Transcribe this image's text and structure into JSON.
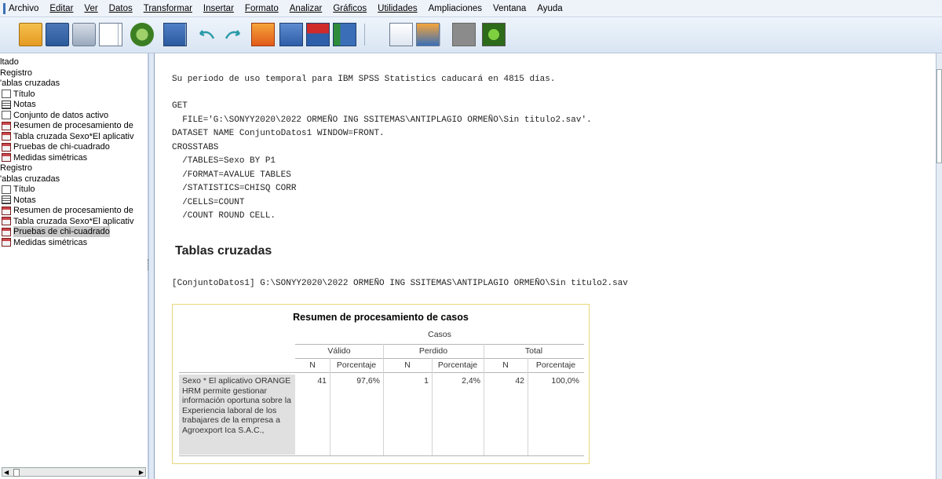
{
  "menu": [
    "Archivo",
    "Editar",
    "Ver",
    "Datos",
    "Transformar",
    "Insertar",
    "Formato",
    "Analizar",
    "Gráficos",
    "Utilidades",
    "Ampliaciones",
    "Ventana",
    "Ayuda"
  ],
  "toolbar_icons": [
    "open-icon",
    "save-icon",
    "print-icon",
    "print-preview-icon",
    "export-icon",
    "goto-data-icon",
    "undo-icon",
    "redo-icon",
    "goto-case-icon",
    "goto-variable-icon",
    "insert-case-icon",
    "insert-variable-icon",
    "edit-icon",
    "script-icon",
    "disabled-icon",
    "add-output-icon"
  ],
  "outline": [
    {
      "label": "ltado",
      "indent": 0,
      "icon": "none"
    },
    {
      "label": "Registro",
      "indent": 0,
      "icon": "none"
    },
    {
      "label": "'ablas cruzadas",
      "indent": 0,
      "icon": "none"
    },
    {
      "label": "Título",
      "indent": 1,
      "icon": "doc"
    },
    {
      "label": "Notas",
      "indent": 1,
      "icon": "note"
    },
    {
      "label": "Conjunto de datos activo",
      "indent": 1,
      "icon": "doc"
    },
    {
      "label": "Resumen de procesamiento de",
      "indent": 1,
      "icon": "tbl"
    },
    {
      "label": "Tabla cruzada Sexo*El aplicativ",
      "indent": 1,
      "icon": "tbl"
    },
    {
      "label": "Pruebas de chi-cuadrado",
      "indent": 1,
      "icon": "tbl"
    },
    {
      "label": "Medidas simétricas",
      "indent": 1,
      "icon": "tbl"
    },
    {
      "label": "Registro",
      "indent": 0,
      "icon": "none"
    },
    {
      "label": "'ablas cruzadas",
      "indent": 0,
      "icon": "none"
    },
    {
      "label": "Título",
      "indent": 1,
      "icon": "doc"
    },
    {
      "label": "Notas",
      "indent": 1,
      "icon": "note"
    },
    {
      "label": "Resumen de procesamiento de",
      "indent": 1,
      "icon": "tbl"
    },
    {
      "label": "Tabla cruzada Sexo*El aplicativ",
      "indent": 1,
      "icon": "tbl"
    },
    {
      "label": "Pruebas de chi-cuadrado",
      "indent": 1,
      "icon": "tbl",
      "selected": true
    },
    {
      "label": "Medidas simétricas",
      "indent": 1,
      "icon": "tbl"
    }
  ],
  "content": {
    "license_msg": "Su periodo de uso temporal para IBM SPSS Statistics caducará en 4815 días.",
    "syntax": [
      "GET",
      "  FILE='G:\\SONYY2020\\2022 ORMEÑO ING SSITEMAS\\ANTIPLAGIO ORMEÑO\\Sin titulo2.sav'.",
      "DATASET NAME ConjuntoDatos1 WINDOW=FRONT.",
      "CROSSTABS",
      "  /TABLES=Sexo BY P1",
      "  /FORMAT=AVALUE TABLES",
      "  /STATISTICS=CHISQ CORR",
      "  /CELLS=COUNT",
      "  /COUNT ROUND CELL."
    ],
    "section_title": "Tablas cruzadas",
    "dataset_line": "[ConjuntoDatos1] G:\\SONYY2020\\2022 ORMEÑO ING SSITEMAS\\ANTIPLAGIO ORMEÑO\\Sin titulo2.sav"
  },
  "case_table": {
    "title": "Resumen de procesamiento de casos",
    "group": "Casos",
    "columns": [
      "Válido",
      "Perdido",
      "Total"
    ],
    "subcolumns": [
      "N",
      "Porcentaje",
      "N",
      "Porcentaje",
      "N",
      "Porcentaje"
    ],
    "row_label": "Sexo * El aplicativo ORANGE HRM permite gestionar información oportuna sobre la Experiencia laboral de los trabajares de la empresa a Agroexport Ica S.A.C.,",
    "values": [
      "41",
      "97,6%",
      "1",
      "2,4%",
      "42",
      "100,0%"
    ]
  }
}
